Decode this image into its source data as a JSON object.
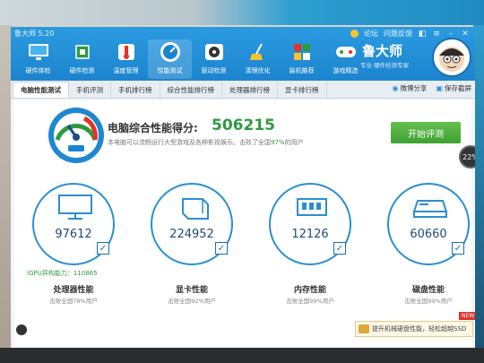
{
  "window": {
    "title": "鲁大师 5.20"
  },
  "window_controls": {
    "forum": "论坛",
    "feedback": "问题反馈"
  },
  "toolbar": {
    "items": [
      {
        "label": "硬件体检",
        "icon": "monitor-icon"
      },
      {
        "label": "硬件检测",
        "icon": "chip-icon"
      },
      {
        "label": "温度管理",
        "icon": "thermometer-icon"
      },
      {
        "label": "性能测试",
        "icon": "speedometer-icon",
        "active": true
      },
      {
        "label": "驱动检测",
        "icon": "driver-icon"
      },
      {
        "label": "清理优化",
        "icon": "broom-icon"
      },
      {
        "label": "装机推荐",
        "icon": "cube-icon"
      },
      {
        "label": "游戏精选",
        "icon": "gamepad-icon"
      }
    ]
  },
  "brand": {
    "name": "鲁大师",
    "slogan": "专业·硬件检测专家"
  },
  "tabs": {
    "items": [
      "电脑性能测试",
      "手机评测",
      "手机排行榜",
      "综合性能排行榜",
      "处理器排行榜",
      "显卡排行榜"
    ],
    "share": "微博分享",
    "save": "保存截屏"
  },
  "score": {
    "label": "电脑综合性能得分:",
    "value": "506215",
    "desc_prefix": "本电脑可以流畅运行大型游戏及各种影视娱乐。击败了全国",
    "percent": "97%",
    "desc_suffix": "的用户"
  },
  "start_button": "开始评测",
  "progress_badge": "22%",
  "cards": [
    {
      "value": "97612",
      "title": "处理器性能",
      "sub": "击败全国78%用户",
      "icon": "monitor-icon",
      "igpu": "IGPU异构能力：110865"
    },
    {
      "value": "224952",
      "title": "显卡性能",
      "sub": "击败全国92%用户",
      "icon": "gpu-icon"
    },
    {
      "value": "12126",
      "title": "内存性能",
      "sub": "击败全国99%用户",
      "icon": "memory-icon"
    },
    {
      "value": "60660",
      "title": "磁盘性能",
      "sub": "击败全国99%用户",
      "icon": "disk-icon"
    }
  ],
  "ssd_hint": "提升机械硬盘性能，轻松超越SSD",
  "new_badge": "NEW",
  "colors": {
    "header": "#1c84cf",
    "accent_green": "#2e9a3e",
    "ring_blue": "#2a8fd2"
  }
}
